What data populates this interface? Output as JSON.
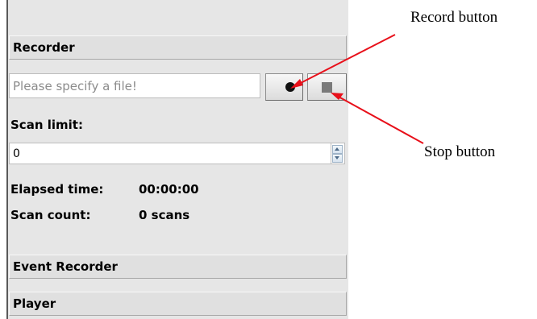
{
  "recorder": {
    "title": "Recorder",
    "file_placeholder": "Please specify a file!",
    "file_value": "",
    "scan_limit_label": "Scan limit:",
    "scan_limit_value": "0",
    "elapsed_time_label": "Elapsed time:",
    "elapsed_time_value": "00:00:00",
    "scan_count_label": "Scan count:",
    "scan_count_value": "0 scans"
  },
  "sections": {
    "event_recorder": "Event Recorder",
    "player": "Player"
  },
  "callouts": {
    "record": "Record button",
    "stop": "Stop button",
    "arrow_color": "#e8101a"
  },
  "icons": {
    "record": "record-icon",
    "stop": "stop-icon",
    "spinner_up": "spinner-up-icon",
    "spinner_down": "spinner-down-icon"
  }
}
